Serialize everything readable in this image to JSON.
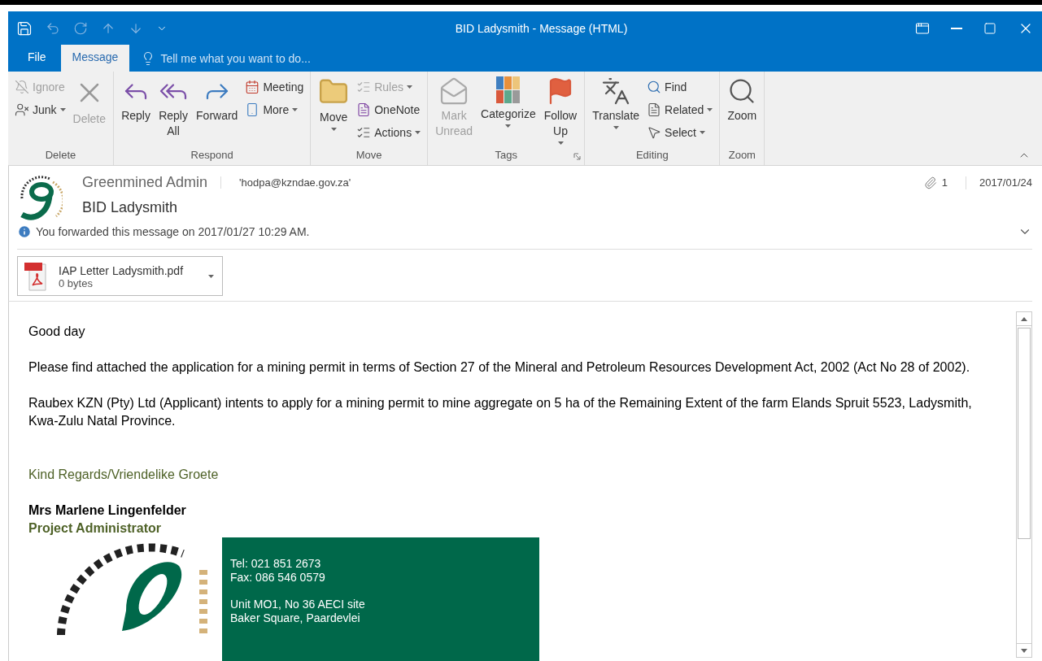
{
  "window": {
    "title": "BID Ladysmith - Message (HTML)"
  },
  "tabs": [
    {
      "label": "File",
      "selected": false
    },
    {
      "label": "Message",
      "selected": true
    }
  ],
  "tell_me": {
    "placeholder": "Tell me what you want to do..."
  },
  "ribbon": {
    "groups": [
      {
        "label": "Delete",
        "items": [
          {
            "kind": "stack",
            "buttons": [
              {
                "label": "Ignore",
                "disabled": true,
                "dropdown": false
              },
              {
                "label": "Junk",
                "disabled": false,
                "dropdown": true
              }
            ]
          },
          {
            "kind": "large",
            "label": "Delete",
            "disabled": true,
            "dropdown": false
          }
        ]
      },
      {
        "label": "Respond",
        "items": [
          {
            "kind": "large",
            "label": "Reply",
            "disabled": false,
            "dropdown": false
          },
          {
            "kind": "large",
            "label": "Reply All",
            "disabled": false,
            "dropdown": false
          },
          {
            "kind": "large",
            "label": "Forward",
            "disabled": false,
            "dropdown": false
          },
          {
            "kind": "stack",
            "buttons": [
              {
                "label": "Meeting",
                "disabled": false,
                "dropdown": false
              },
              {
                "label": "More",
                "disabled": false,
                "dropdown": true
              }
            ]
          }
        ]
      },
      {
        "label": "Move",
        "items": [
          {
            "kind": "large",
            "label": "Move",
            "disabled": false,
            "dropdown": true
          },
          {
            "kind": "stack",
            "buttons": [
              {
                "label": "Rules",
                "disabled": true,
                "dropdown": true
              },
              {
                "label": "OneNote",
                "disabled": false,
                "dropdown": false
              },
              {
                "label": "Actions",
                "disabled": false,
                "dropdown": true
              }
            ]
          }
        ]
      },
      {
        "label": "Tags",
        "launcher": true,
        "items": [
          {
            "kind": "large",
            "label": "Mark Unread",
            "disabled": true,
            "dropdown": false
          },
          {
            "kind": "large",
            "label": "Categorize",
            "disabled": false,
            "dropdown": true
          },
          {
            "kind": "large",
            "label": "Follow Up",
            "disabled": false,
            "dropdown": true
          }
        ]
      },
      {
        "label": "Editing",
        "items": [
          {
            "kind": "large",
            "label": "Translate",
            "disabled": false,
            "dropdown": true
          },
          {
            "kind": "stack",
            "buttons": [
              {
                "label": "Find",
                "disabled": false,
                "dropdown": false
              },
              {
                "label": "Related",
                "disabled": false,
                "dropdown": true
              },
              {
                "label": "Select",
                "disabled": false,
                "dropdown": true
              }
            ]
          }
        ]
      },
      {
        "label": "Zoom",
        "items": [
          {
            "kind": "large",
            "label": "Zoom",
            "disabled": false,
            "dropdown": false
          }
        ]
      }
    ]
  },
  "message": {
    "sender": "Greenmined Admin",
    "to": "'hodpa@kzndae.gov.za'",
    "subject": "BID Ladysmith",
    "attachment_count": "1",
    "date": "2017/01/24",
    "info": "You forwarded this message on 2017/01/27 10:29 AM.",
    "attachments": [
      {
        "name": "IAP Letter Ladysmith.pdf",
        "size": "0 bytes"
      }
    ]
  },
  "body": {
    "paragraphs": [
      {
        "kind": "plain",
        "text": "Good day"
      },
      {
        "kind": "plain",
        "text": "Please find attached the application for a mining permit in terms of Section 27 of the Mineral and Petroleum Resources Development Act, 2002 (Act No 28 of 2002)."
      },
      {
        "kind": "plain",
        "text": "Raubex KZN (Pty) Ltd (Applicant) intents to apply for a mining permit to mine aggregate on 5 ha of the Remaining Extent of the farm Elands Spruit 5523, Ladysmith, Kwa-Zulu Natal Province."
      },
      {
        "kind": "closing",
        "text": "Kind Regards/Vriendelike Groete"
      },
      {
        "kind": "name",
        "text": "Mrs Marlene Lingenfelder"
      },
      {
        "kind": "role",
        "text": "Project Administrator"
      }
    ],
    "contact": [
      [
        "Tel: 021 851 2673",
        "Fax: 086 546 0579"
      ],
      [
        "Unit MO1, No 36 AECI site",
        "Baker Square, Paardevlei"
      ]
    ]
  }
}
